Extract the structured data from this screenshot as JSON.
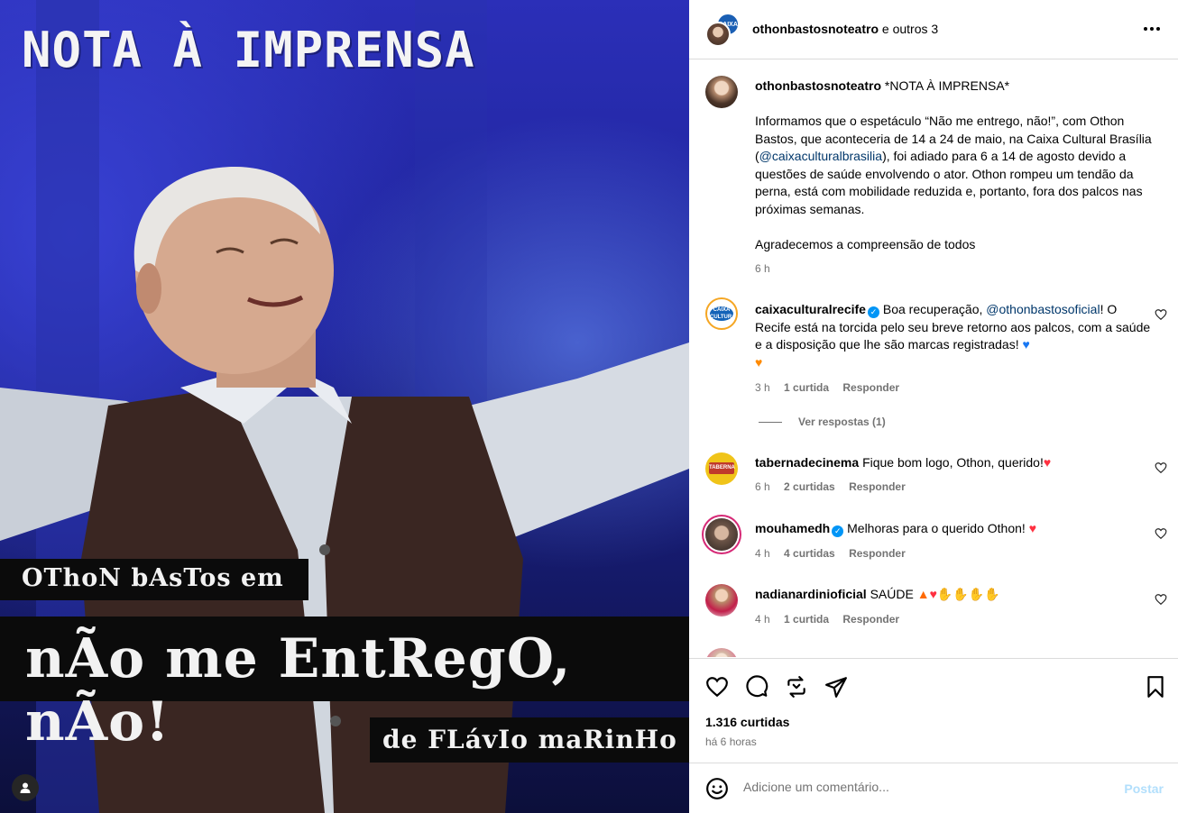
{
  "media": {
    "title": "NOTA À IMPRENSA",
    "line1": "OThoN bAsTos em",
    "line2": "nÃo me EntRegO, nÃo!",
    "line3": "de FLávIo maRinHo"
  },
  "header": {
    "username": "othonbastosnoteatro",
    "suffix": "e outros 3"
  },
  "caption": {
    "username": "othonbastosnoteatro",
    "headline": "*NOTA À IMPRENSA*",
    "p1_a": "Informamos que o espetáculo “Não me entrego, não!”, com Othon Bastos, que aconteceria de 14 a 24 de maio, na Caixa Cultural Brasília (",
    "p1_mention": "@caixaculturalbrasilia",
    "p1_b": "), foi adiado para 6 a 14 de agosto devido a questões de saúde envolvendo o ator. Othon rompeu um tendão da perna, está com mobilidade reduzida e, portanto, fora dos palcos nas próximas semanas.",
    "p2": "Agradecemos a compreensão de todos",
    "time": "6 h"
  },
  "comments": [
    {
      "username": "caixaculturalrecife",
      "text_a": "Boa recuperação,",
      "mention": "@othonbastosoficial",
      "text_b": "! O Recife está na torcida pelo seu breve retorno aos palcos, com a saúde e a disposição que lhe são marcas registradas!",
      "time": "3 h",
      "likes": "1 curtida",
      "reply": "Responder",
      "view_replies": "Ver respostas (1)"
    },
    {
      "username": "tabernadecinema",
      "text": "Fique bom logo, Othon, querido!",
      "time": "6 h",
      "likes": "2 curtidas",
      "reply": "Responder"
    },
    {
      "username": "mouhamedh",
      "text": "Melhoras para o querido Othon!",
      "time": "4 h",
      "likes": "4 curtidas",
      "reply": "Responder"
    },
    {
      "username": "nadianardinioficial",
      "text": "SAÚDE",
      "time": "4 h",
      "likes": "1 curtida",
      "reply": "Responder"
    }
  ],
  "footer": {
    "likes": "1.316 curtidas",
    "time_ago": "há 6 horas",
    "comment_placeholder": "Adicione um comentário...",
    "post_label": "Postar"
  }
}
